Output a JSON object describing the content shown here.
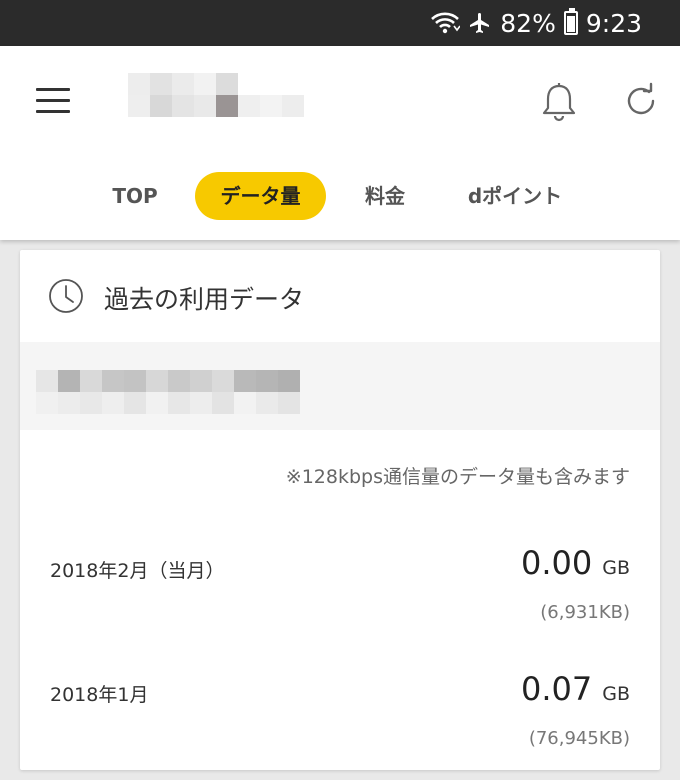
{
  "status_bar": {
    "battery": "82%",
    "time": "9:23",
    "icons": [
      "wifi-icon",
      "airplane-icon",
      "battery-icon"
    ]
  },
  "header": {
    "menu_icon": "hamburger-menu-icon",
    "notification_icon": "bell-icon",
    "refresh_icon": "refresh-icon"
  },
  "tabs": [
    {
      "label": "TOP"
    },
    {
      "label": "データ量"
    },
    {
      "label": "料金"
    },
    {
      "label": "dポイント"
    }
  ],
  "active_tab_color": "#f7c900",
  "card": {
    "title": "過去の利用データ",
    "title_icon": "clock-icon",
    "note": "※128kbps通信量のデータ量も含みます",
    "rows": [
      {
        "label": "2018年2月（当月）",
        "value": "0.00",
        "unit": "GB",
        "kb": "(6,931KB)"
      },
      {
        "label": "2018年1月",
        "value": "0.07",
        "unit": "GB",
        "kb": "(76,945KB)"
      }
    ]
  }
}
